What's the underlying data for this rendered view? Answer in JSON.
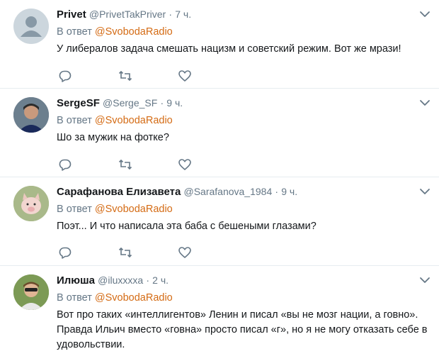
{
  "icons": {
    "reply": "reply-icon",
    "retweet": "retweet-icon",
    "like": "heart-icon",
    "caret": "chevron-down-icon"
  },
  "colors": {
    "link": "#d46b14",
    "muted": "#657786",
    "text": "#14171a",
    "divider": "#e6ecf0"
  },
  "tweets": [
    {
      "name": "Privet",
      "handle": "@PrivetTakPriver",
      "separator": "·",
      "time": "7 ч.",
      "reply_prefix": "В ответ",
      "reply_user": "@SvobodaRadio",
      "text": "У либералов задача смешать нацизм и советский режим. Вот же мрази!"
    },
    {
      "name": "SergeSF",
      "handle": "@Serge_SF",
      "separator": "·",
      "time": "9 ч.",
      "reply_prefix": "В ответ",
      "reply_user": "@SvobodaRadio",
      "text": "Шо за мужик на фотке?"
    },
    {
      "name": "Сарафанова Елизавета",
      "handle": "@Sarafanova_1984",
      "separator": "·",
      "time": "9 ч.",
      "reply_prefix": "В ответ",
      "reply_user": "@SvobodaRadio",
      "text": "Поэт... И что написала эта баба с бешеными глазами?"
    },
    {
      "name": "Илюша",
      "handle": "@iluxxxxa",
      "separator": "·",
      "time": "2 ч.",
      "reply_prefix": "В ответ",
      "reply_user": "@SvobodaRadio",
      "text": "Вот про таких «интеллигентов» Ленин и писал «вы не мозг нации, а говно». Правда Ильич вместо «говна» просто писал «г», но я не могу отказать себе в удовольствии."
    }
  ]
}
